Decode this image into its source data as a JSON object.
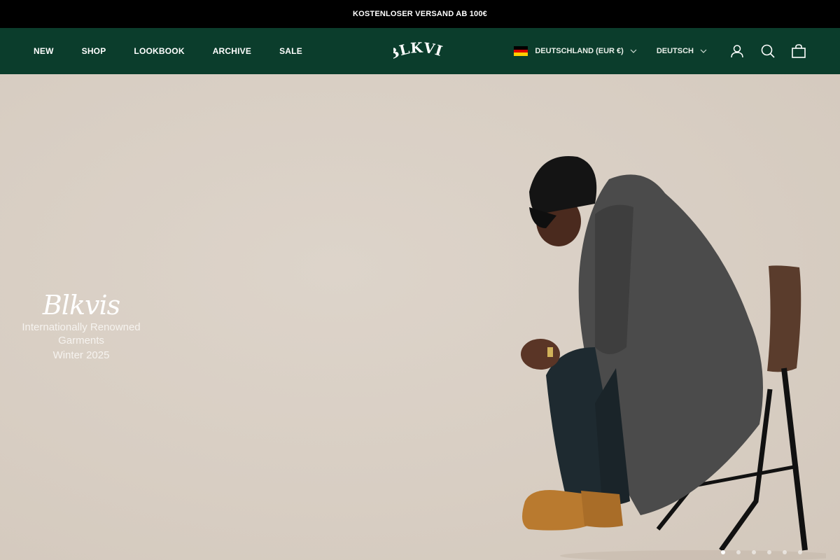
{
  "announcement": "KOSTENLOSER VERSAND AB 100€",
  "nav": {
    "items": [
      "NEW",
      "SHOP",
      "LOOKBOOK",
      "ARCHIVE",
      "SALE"
    ]
  },
  "logo": "BLKVIS",
  "locale": {
    "country": "DEUTSCHLAND (EUR €)",
    "language": "DEUTSCH"
  },
  "icons": [
    "flag-germany-icon",
    "chevron-down-icon",
    "account-icon",
    "search-icon",
    "cart-icon"
  ],
  "hero": {
    "brand": "Blkvis",
    "tagline": "Internationally Renowned Garments",
    "season": "Winter 2025"
  },
  "slideshow": {
    "total_slides": 6,
    "active_slide": 1
  },
  "colors": {
    "announcement_bg": "#000000",
    "header_bg": "#0b3d2c",
    "hero_bg": "#d9cfc4"
  }
}
